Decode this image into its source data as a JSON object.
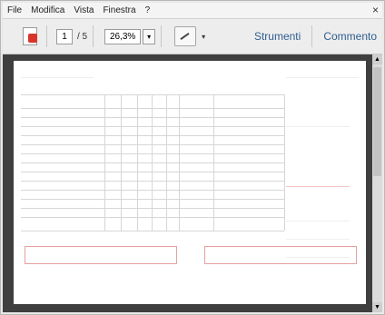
{
  "menu": {
    "items": [
      "File",
      "Modifica",
      "Vista",
      "Finestra",
      "?"
    ],
    "close": "×"
  },
  "toolbar": {
    "current_page": "1",
    "page_total": "/ 5",
    "zoom": "26,3%",
    "dropdown_glyph": "▾",
    "tools_label": "Strumenti",
    "comment_label": "Commento"
  },
  "scroll": {
    "up": "▲",
    "down": "▼"
  },
  "colors": {
    "link": "#2f5f8f",
    "accent_red": "#d04a4a",
    "doc_background": "#3f3f3f"
  }
}
